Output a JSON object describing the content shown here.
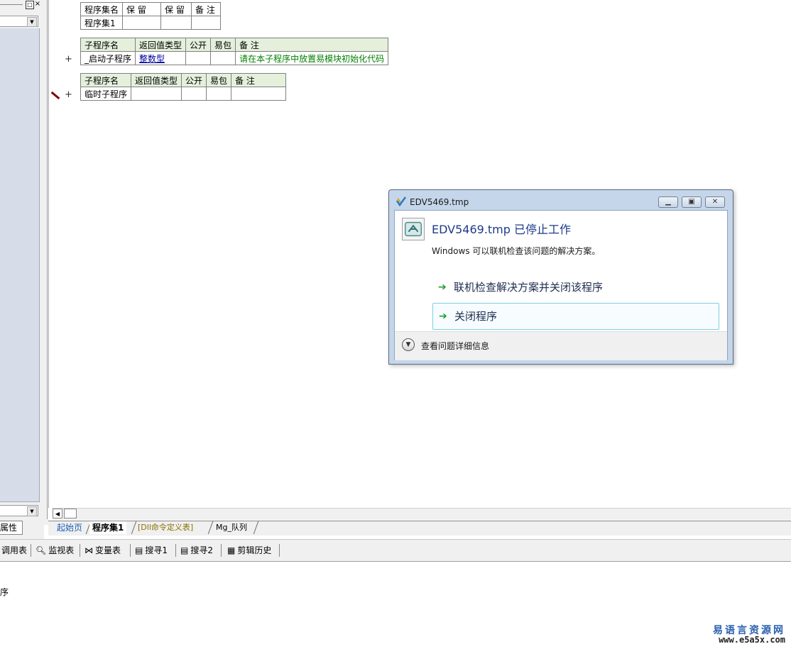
{
  "left_panel": {
    "pin_icon": "pin-icon",
    "close_glyph": "×",
    "properties_tab": "属性"
  },
  "tables": {
    "assembly": {
      "headers": [
        "程序集名",
        "保 留",
        "保 留",
        "备 注"
      ],
      "row": [
        "程序集1",
        "",
        "",
        ""
      ]
    },
    "sub_start": {
      "headers": [
        "子程序名",
        "返回值类型",
        "公开",
        "易包",
        "备 注"
      ],
      "row": [
        "_启动子程序",
        "整数型",
        "",
        "",
        "请在本子程序中放置易模块初始化代码"
      ]
    },
    "sub_temp": {
      "headers": [
        "子程序名",
        "返回值类型",
        "公开",
        "易包",
        "备 注"
      ],
      "row": [
        "临时子程序",
        "",
        "",
        "",
        ""
      ]
    },
    "plus_glyph": "+"
  },
  "doc_tabs": [
    "起始页",
    "程序集1",
    "[Dll命令定义表]",
    "Mg_队列"
  ],
  "bottom_toolbar": {
    "items": [
      {
        "icon": "call-table-icon",
        "label": "调用表"
      },
      {
        "icon": "magnifier-icon",
        "label": "监视表"
      },
      {
        "icon": "variable-icon",
        "label": "变量表"
      },
      {
        "icon": "search-doc-icon",
        "label": "搜寻1"
      },
      {
        "icon": "search-doc-icon",
        "label": "搜寻2"
      },
      {
        "icon": "clipboard-icon",
        "label": "剪辑历史"
      }
    ]
  },
  "output": {
    "text": "序"
  },
  "watermark": {
    "title": "易语言资源网",
    "url": "www.e5a5x.com"
  },
  "dialog": {
    "title": "EDV5469.tmp",
    "heading": "EDV5469.tmp 已停止工作",
    "description": "Windows 可以联机检查该问题的解决方案。",
    "option_online": "联机检查解决方案并关闭该程序",
    "option_close": "关闭程序",
    "details": "查看问题详细信息",
    "arrow_glyph": "➔",
    "accent_color": "#1f9b2e"
  }
}
